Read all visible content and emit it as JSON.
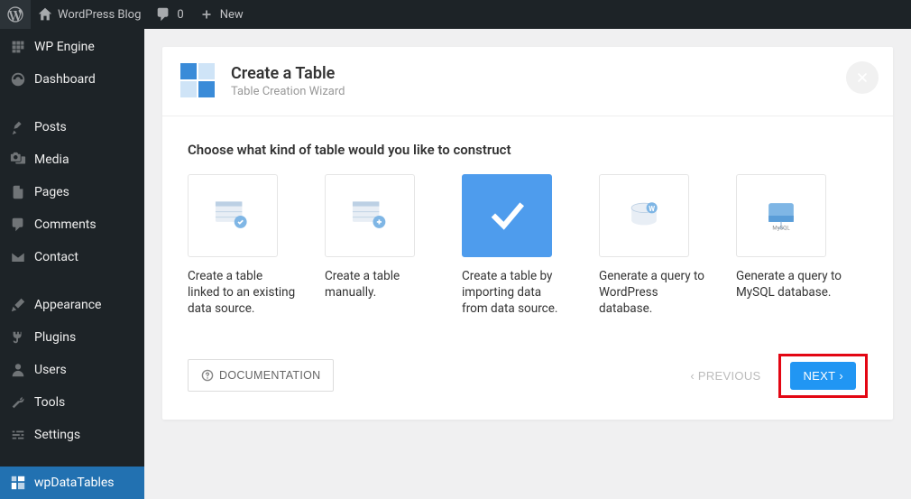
{
  "adminbar": {
    "site_title": "WordPress Blog",
    "comments_count": "0",
    "new_label": "New"
  },
  "sidebar": {
    "items": [
      {
        "id": "wp-engine",
        "label": "WP Engine"
      },
      {
        "id": "dashboard",
        "label": "Dashboard"
      },
      {
        "id": "posts",
        "label": "Posts"
      },
      {
        "id": "media",
        "label": "Media"
      },
      {
        "id": "pages",
        "label": "Pages"
      },
      {
        "id": "comments",
        "label": "Comments"
      },
      {
        "id": "contact",
        "label": "Contact"
      },
      {
        "id": "appearance",
        "label": "Appearance"
      },
      {
        "id": "plugins",
        "label": "Plugins"
      },
      {
        "id": "users",
        "label": "Users"
      },
      {
        "id": "tools",
        "label": "Tools"
      },
      {
        "id": "settings",
        "label": "Settings"
      },
      {
        "id": "wpdatatables",
        "label": "wpDataTables"
      }
    ]
  },
  "wizard": {
    "title": "Create a Table",
    "subtitle": "Table Creation Wizard",
    "section_title": "Choose what kind of table would you like to construct",
    "options": [
      {
        "label": "Create a table linked to an existing data source."
      },
      {
        "label": "Create a table manually."
      },
      {
        "label": "Create a table by importing data from data source.",
        "selected": true
      },
      {
        "label": "Generate a query to WordPress database."
      },
      {
        "label": "Generate a query to MySQL database."
      }
    ],
    "doc_label": "DOCUMENTATION",
    "prev_label": "PREVIOUS",
    "next_label": "NEXT"
  }
}
